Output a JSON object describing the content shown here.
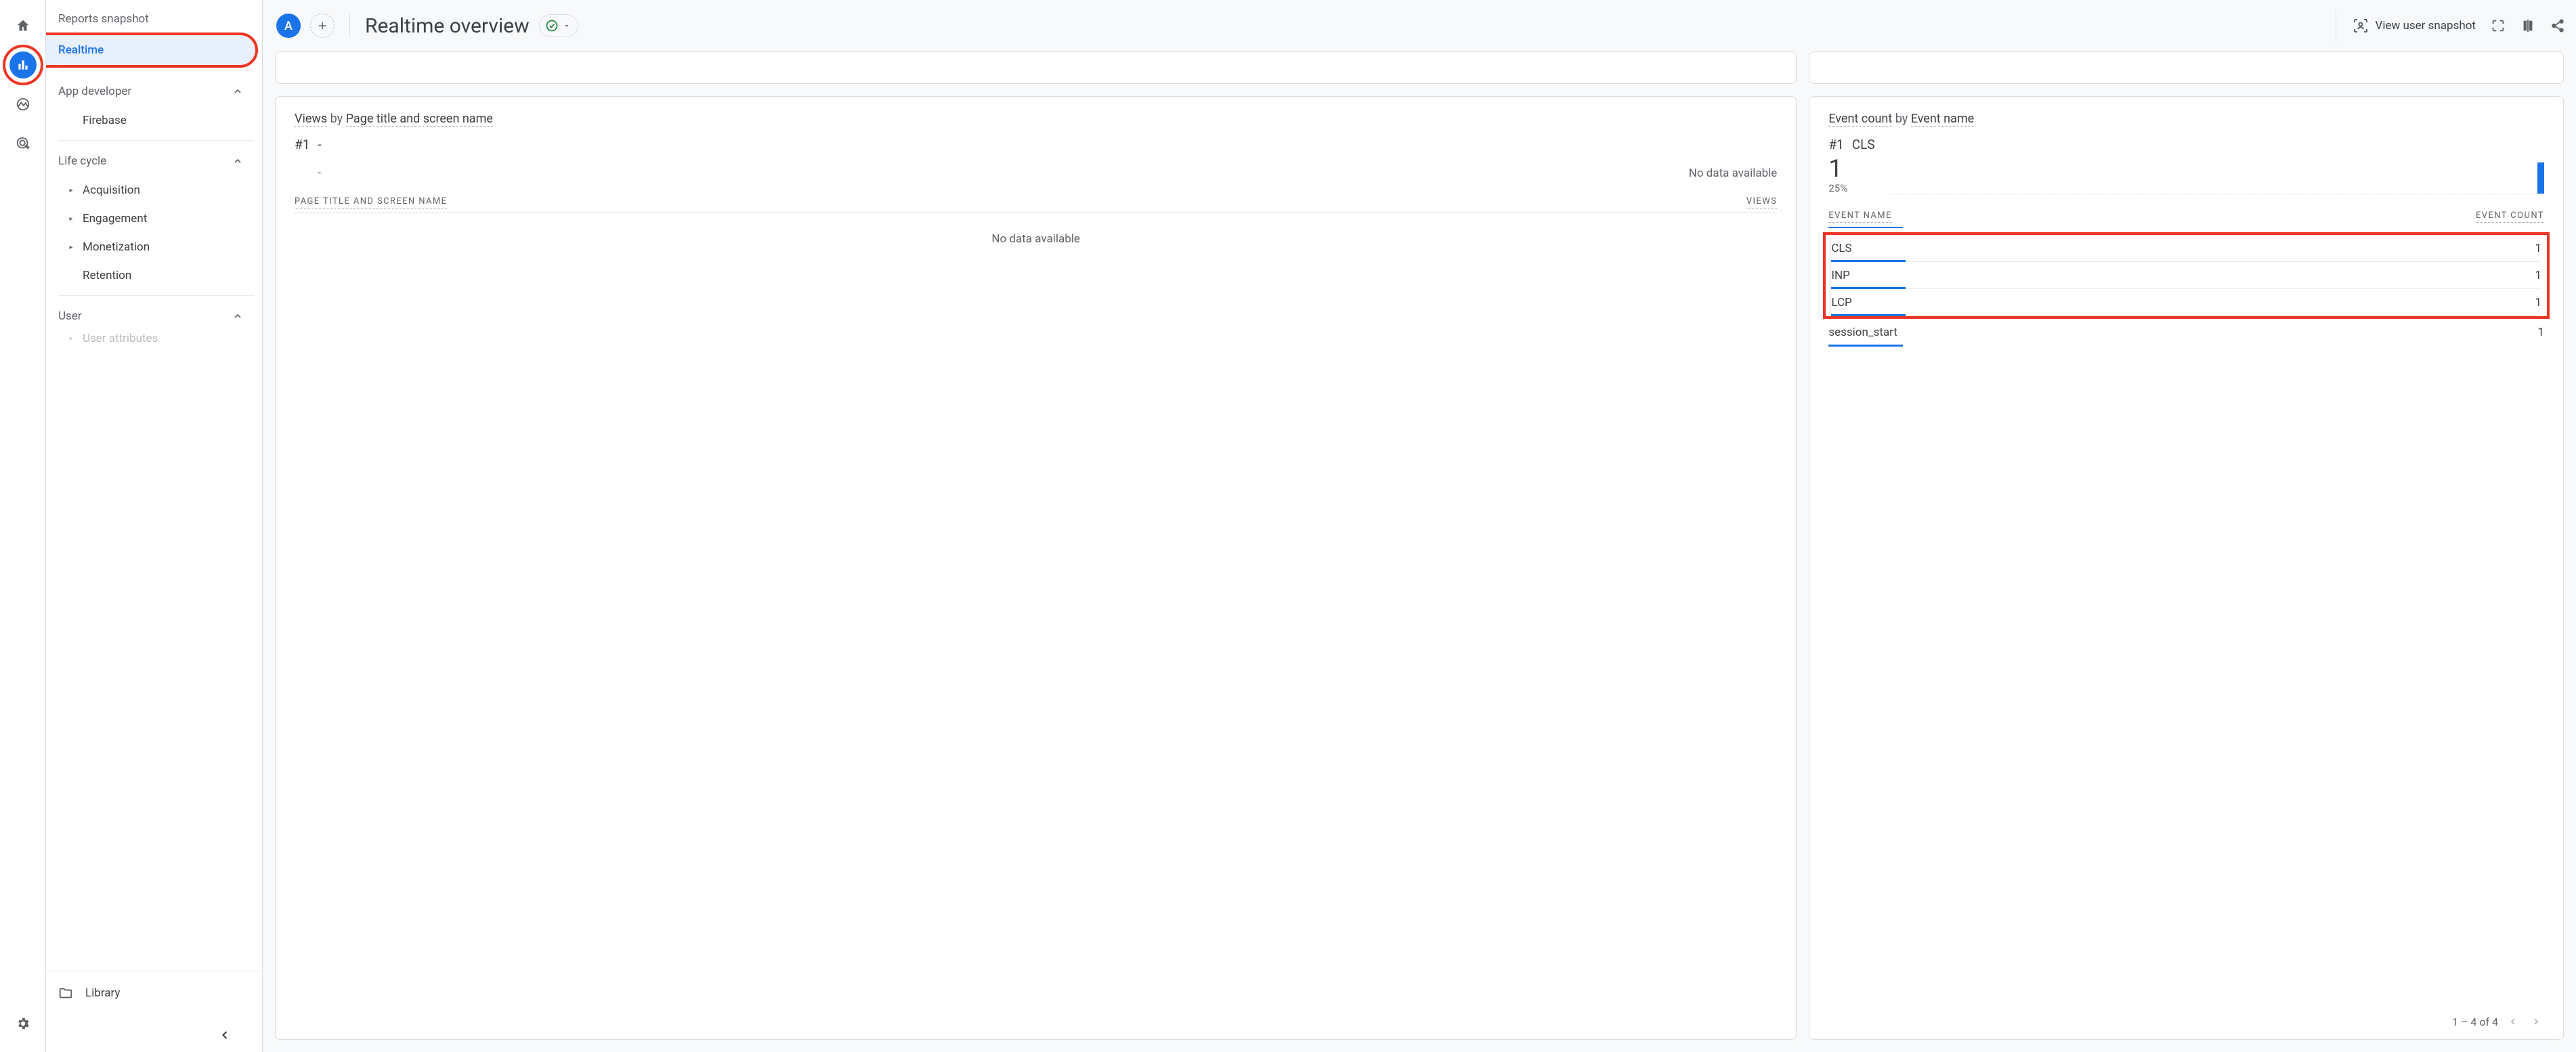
{
  "rail": {
    "active_index": 1
  },
  "nav": {
    "reports_snapshot": "Reports snapshot",
    "realtime": "Realtime",
    "groups": {
      "app_developer": {
        "label": "App developer",
        "items": [
          "Firebase"
        ]
      },
      "life_cycle": {
        "label": "Life cycle",
        "items": [
          "Acquisition",
          "Engagement",
          "Monetization",
          "Retention"
        ]
      },
      "user": {
        "label": "User",
        "items_truncated": "User attributes"
      }
    },
    "library": "Library"
  },
  "header": {
    "audience_letter": "A",
    "title": "Realtime overview",
    "user_snapshot": "View user snapshot"
  },
  "views_card": {
    "title_prefix": "Views",
    "title_by": "by",
    "title_dim": "Page title and screen name",
    "rank": "#1",
    "rank_value": "-",
    "no_data_top": "No data available",
    "col_left": "PAGE TITLE AND SCREEN NAME",
    "col_right": "VIEWS",
    "no_data_body": "No data available"
  },
  "events_card": {
    "title_prefix": "Event count",
    "title_by": "by",
    "title_dim": "Event name",
    "rank": "#1",
    "rank_value": "CLS",
    "big_number": "1",
    "percent": "25%",
    "col_left": "EVENT NAME",
    "col_right": "EVENT COUNT",
    "rows": [
      {
        "name": "CLS",
        "count": "1"
      },
      {
        "name": "INP",
        "count": "1"
      },
      {
        "name": "LCP",
        "count": "1"
      },
      {
        "name": "session_start",
        "count": "1"
      }
    ],
    "pager": "1 – 4 of 4"
  },
  "chart_data": {
    "type": "bar",
    "title": "Event count by Event name",
    "xlabel": "Event name",
    "ylabel": "Event count",
    "categories": [
      "CLS",
      "INP",
      "LCP",
      "session_start"
    ],
    "values": [
      1,
      1,
      1,
      1
    ],
    "ylim": [
      0,
      1
    ]
  }
}
